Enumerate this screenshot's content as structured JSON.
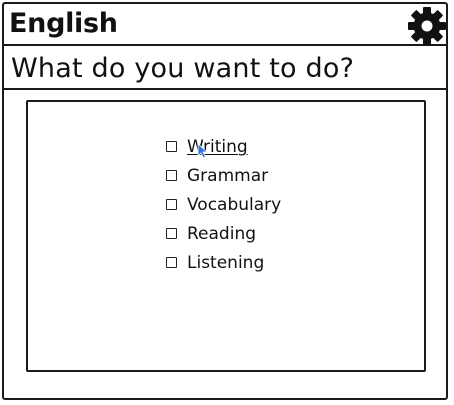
{
  "window": {
    "title": "English"
  },
  "header": {
    "settings_icon": "gear-icon"
  },
  "main": {
    "question": "What do you want to do?",
    "options": [
      {
        "label": "Writing",
        "checked": false,
        "hovered": true
      },
      {
        "label": "Grammar",
        "checked": false
      },
      {
        "label": "Vocabulary",
        "checked": false
      },
      {
        "label": "Reading",
        "checked": false
      },
      {
        "label": "Listening",
        "checked": false
      }
    ]
  },
  "colors": {
    "ink": "#1a1a1a",
    "cursor": "#2f6fd6",
    "background": "#ffffff"
  }
}
